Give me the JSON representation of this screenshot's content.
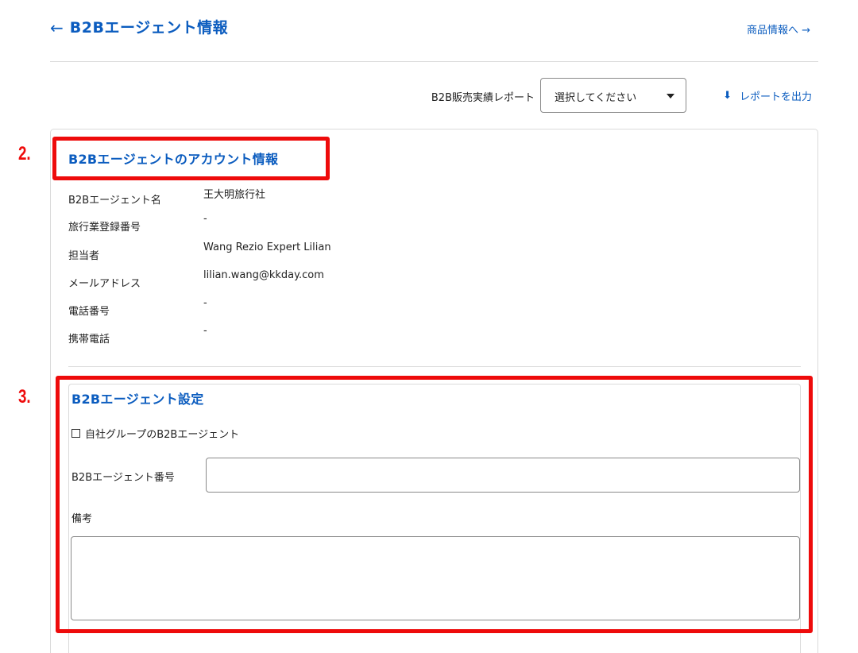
{
  "header": {
    "back_arrow": "←",
    "title": "B2Bエージェント情報",
    "product_link": "商品情報へ →"
  },
  "report": {
    "label": "B2B販売実績レポート",
    "select_value": "選択してください",
    "export_icon": "⬇",
    "export_label": "レポートを出力"
  },
  "account": {
    "section_title": "B2Bエージェントのアカウント情報",
    "rows": [
      {
        "label": "B2Bエージェント名",
        "value": "王大明旅行社"
      },
      {
        "label": "旅行業登録番号",
        "value": "-"
      },
      {
        "label": "担当者",
        "value": "Wang Rezio Expert Lilian"
      },
      {
        "label": "メールアドレス",
        "value": "lilian.wang@kkday.com"
      },
      {
        "label": "電話番号",
        "value": "-"
      },
      {
        "label": "携帯電話",
        "value": "-"
      }
    ]
  },
  "settings": {
    "section_title": "B2Bエージェント設定",
    "checkbox_label": "自社グループのB2Bエージェント",
    "agent_number_label": "B2Bエージェント番号",
    "agent_number_value": "",
    "remarks_label": "備考",
    "remarks_value": ""
  },
  "annotations": {
    "callout_2": "2.",
    "callout_3": "3.",
    "color": "#ee0b0b"
  },
  "colors": {
    "accent": "#0b5cbf",
    "border": "#dadada"
  }
}
